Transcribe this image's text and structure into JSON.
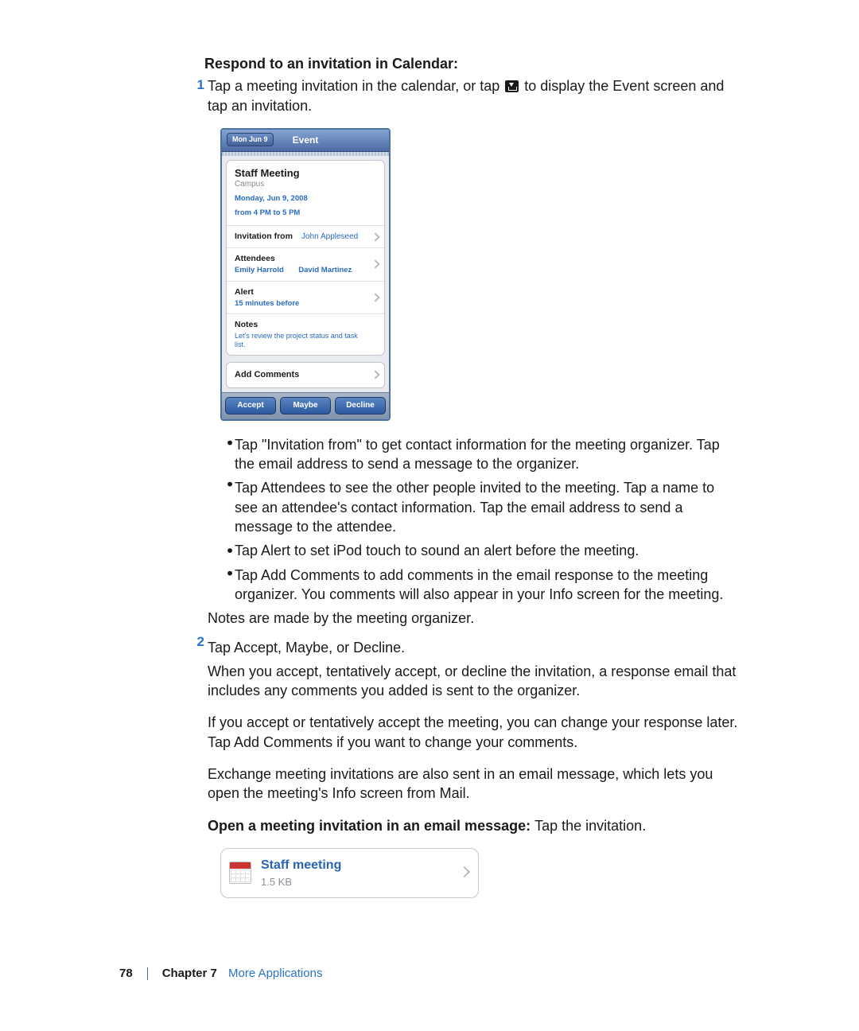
{
  "heading": "Respond to an invitation in Calendar:",
  "step1": {
    "num": "1",
    "text_a": "Tap a meeting invitation in the calendar, or tap ",
    "text_b": " to display the Event screen and tap an invitation."
  },
  "event": {
    "back": "Mon Jun 9",
    "title": "Event",
    "meeting_title": "Staff Meeting",
    "location": "Campus",
    "date": "Monday, Jun 9, 2008",
    "time": "from 4 PM to 5 PM",
    "inv_label": "Invitation from",
    "inv_from": "John Appleseed",
    "att_label": "Attendees",
    "att1": "Emily Harrold",
    "att2": "David Martinez",
    "alert_label": "Alert",
    "alert_val": "15 minutes before",
    "notes_label": "Notes",
    "notes_val": "Let's review the project status and task list.",
    "add_comments": "Add Comments",
    "btn_accept": "Accept",
    "btn_maybe": "Maybe",
    "btn_decline": "Decline"
  },
  "bullets": [
    "Tap \"Invitation from\" to get contact information for the meeting organizer. Tap the email address to send a message to the organizer.",
    "Tap Attendees to see the other people invited to the meeting. Tap a name to see an attendee's contact information. Tap the email address to send a message to the attendee.",
    "Tap Alert to set iPod touch to sound an alert before the meeting.",
    "Tap Add Comments to add comments in the email response to the meeting organizer. You comments will also appear in your Info screen for the meeting."
  ],
  "after_bullets": "Notes are made by the meeting organizer.",
  "step2": {
    "num": "2",
    "line1": "Tap Accept, Maybe, or Decline.",
    "line2": "When you accept, tentatively accept, or decline the invitation, a response email that includes any comments you added is sent to the organizer."
  },
  "para1": "If you accept or tentatively accept the meeting, you can change your response later. Tap Add Comments if you want to change your comments.",
  "para2": "Exchange meeting invitations are also sent in an email message, which lets you open the meeting's Info screen from Mail.",
  "para3_bold": "Open a meeting invitation in an email message:  ",
  "para3_rest": "Tap the invitation.",
  "attachment": {
    "title": "Staff meeting",
    "size": "1.5 KB"
  },
  "footer": {
    "page": "78",
    "chapter_label": "Chapter 7",
    "chapter_name": "More Applications"
  }
}
